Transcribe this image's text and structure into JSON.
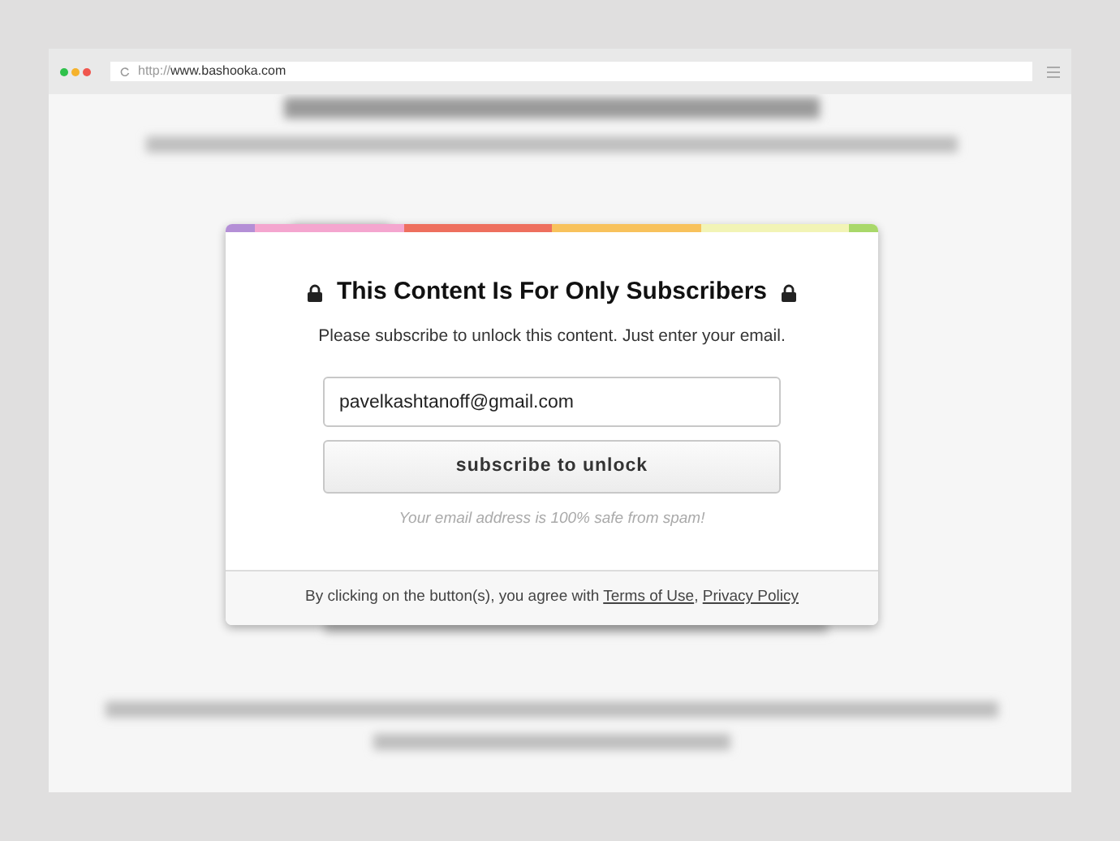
{
  "browser": {
    "url_scheme": "http://",
    "url_host": "www.bashooka.com"
  },
  "stripe": [
    {
      "color": "#b48fd6"
    },
    {
      "color": "#f4a6cf"
    },
    {
      "color": "#ee6f5e"
    },
    {
      "color": "#f8c25c"
    },
    {
      "color": "#f2f4b6"
    },
    {
      "color": "#a9d86a"
    }
  ],
  "modal": {
    "title": "This Content Is For Only Subscribers",
    "subtitle": "Please subscribe to unlock this content. Just enter your email.",
    "email": {
      "value": "pavelkashtanoff@gmail.com"
    },
    "button": "subscribe to unlock",
    "note": "Your email address is 100% safe from spam!",
    "footer": {
      "text": "By clicking on the button(s), you agree with",
      "links": [
        {
          "label": "Terms of Use",
          "separator": ","
        },
        {
          "label": "Privacy Policy"
        }
      ]
    }
  }
}
